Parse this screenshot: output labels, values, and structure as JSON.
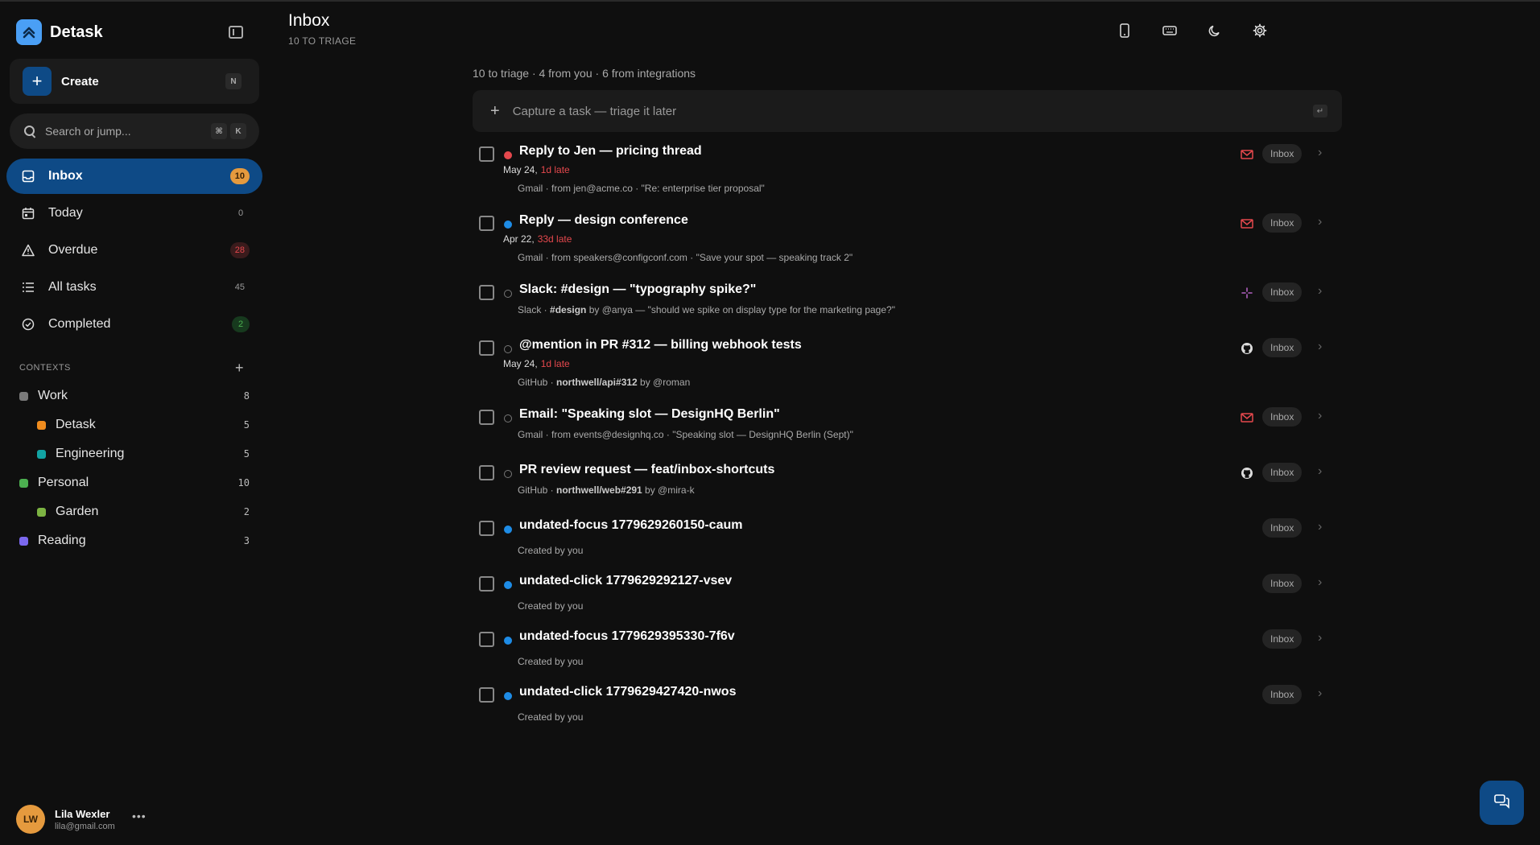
{
  "colors": {
    "background": "#0f0f0f",
    "accent": "#0e4a86",
    "brand": "#4a9ff5",
    "late": "#e5484d",
    "badge_bg": "#242424",
    "inbox_badge": "#e59a3e",
    "overdue_badge": "#e5484d",
    "completed_badge": "#4caf50"
  },
  "sidebar": {
    "app_name": "Detask",
    "brand_icon": "double-chevron-up-icon",
    "collapse_icon": "sidebar-collapse-icon",
    "create": {
      "label": "Create",
      "shortcut": "N",
      "icon": "plus-icon"
    },
    "search": {
      "placeholder": "Search or jump...",
      "shortcut_mod": "⌘",
      "shortcut_key": "K",
      "icon": "search-icon"
    },
    "nav": [
      {
        "id": "inbox",
        "label": "Inbox",
        "count": "10",
        "icon": "inbox-icon",
        "active": true
      },
      {
        "id": "today",
        "label": "Today",
        "count": "0",
        "icon": "calendar-icon",
        "active": false
      },
      {
        "id": "overdue",
        "label": "Overdue",
        "count": "28",
        "icon": "warning-icon",
        "active": false
      },
      {
        "id": "all",
        "label": "All tasks",
        "count": "45",
        "icon": "list-icon",
        "active": false
      },
      {
        "id": "completed",
        "label": "Completed",
        "count": "2",
        "icon": "check-circle-icon",
        "active": false
      }
    ],
    "contexts": {
      "title": "CONTEXTS",
      "add_icon": "plus-icon",
      "items": [
        {
          "label": "Work",
          "count": "8",
          "color": "#7a7a7a",
          "indent": false
        },
        {
          "label": "Detask",
          "count": "5",
          "color": "#f08c1e",
          "indent": true
        },
        {
          "label": "Engineering",
          "count": "5",
          "color": "#12a3a3",
          "indent": true
        },
        {
          "label": "Personal",
          "count": "10",
          "color": "#4caf50",
          "indent": false
        },
        {
          "label": "Garden",
          "count": "2",
          "color": "#7cb342",
          "indent": true
        },
        {
          "label": "Reading",
          "count": "3",
          "color": "#7b68ee",
          "indent": false
        }
      ]
    },
    "user": {
      "initials": "LW",
      "name": "Lila Wexler",
      "email": "lila@gmail.com",
      "more_icon": "more-horizontal-icon"
    }
  },
  "header": {
    "title": "Inbox",
    "subtitle": "10 TO TRIAGE",
    "icons": [
      "phone-icon",
      "keyboard-icon",
      "moon-icon",
      "gear-icon"
    ]
  },
  "main": {
    "summary": "10 to triage · 4 from you · 6 from integrations",
    "capture": {
      "placeholder": "Capture a task — triage it later",
      "enter_glyph": "↵",
      "icon": "plus-icon"
    },
    "tasks": [
      {
        "title": "Reply to Jen — pricing thread",
        "dot": "red",
        "date": "May 24,",
        "late": "1d late",
        "meta_prefix": "Gmail · from jen@acme.co · \"Re: enterprise tier proposal\"",
        "meta_bold": "",
        "meta_suffix": "",
        "source": "mail-icon",
        "badge": "Inbox"
      },
      {
        "title": "Reply — design conference",
        "dot": "blue",
        "date": "Apr 22,",
        "late": "33d late",
        "meta_prefix": "Gmail · from speakers@configconf.com · \"Save your spot — speaking track 2\"",
        "meta_bold": "",
        "meta_suffix": "",
        "source": "mail-icon",
        "badge": "Inbox"
      },
      {
        "title": "Slack: #design — \"typography spike?\"",
        "dot": "ring",
        "date": "",
        "late": "",
        "meta_prefix": "Slack · ",
        "meta_bold": "#design",
        "meta_suffix": " by @anya — \"should we spike on display type for the marketing page?\"",
        "source": "slack-icon",
        "badge": "Inbox"
      },
      {
        "title": "@mention in PR #312 — billing webhook tests",
        "dot": "ring",
        "date": "May 24,",
        "late": "1d late",
        "meta_prefix": "GitHub · ",
        "meta_bold": "northwell/api#312",
        "meta_suffix": " by @roman",
        "source": "github-icon",
        "badge": "Inbox"
      },
      {
        "title": "Email: \"Speaking slot — DesignHQ Berlin\"",
        "dot": "ring",
        "date": "",
        "late": "",
        "meta_prefix": "Gmail · from events@designhq.co · \"Speaking slot — DesignHQ Berlin (Sept)\"",
        "meta_bold": "",
        "meta_suffix": "",
        "source": "mail-icon",
        "badge": "Inbox"
      },
      {
        "title": "PR review request — feat/inbox-shortcuts",
        "dot": "ring",
        "date": "",
        "late": "",
        "meta_prefix": "GitHub · ",
        "meta_bold": "northwell/web#291",
        "meta_suffix": " by @mira-k",
        "source": "github-icon",
        "badge": "Inbox"
      },
      {
        "title": "undated-focus 1779629260150-caum",
        "dot": "blue",
        "date": "",
        "late": "",
        "meta_prefix": "Created by you",
        "meta_bold": "",
        "meta_suffix": "",
        "source": "",
        "badge": "Inbox"
      },
      {
        "title": "undated-click 1779629292127-vsev",
        "dot": "blue",
        "date": "",
        "late": "",
        "meta_prefix": "Created by you",
        "meta_bold": "",
        "meta_suffix": "",
        "source": "",
        "badge": "Inbox"
      },
      {
        "title": "undated-focus 1779629395330-7f6v",
        "dot": "blue",
        "date": "",
        "late": "",
        "meta_prefix": "Created by you",
        "meta_bold": "",
        "meta_suffix": "",
        "source": "",
        "badge": "Inbox"
      },
      {
        "title": "undated-click 1779629427420-nwos",
        "dot": "blue",
        "date": "",
        "late": "",
        "meta_prefix": "Created by you",
        "meta_bold": "",
        "meta_suffix": "",
        "source": "",
        "badge": "Inbox"
      }
    ]
  },
  "fab": {
    "icon": "chat-icon"
  }
}
